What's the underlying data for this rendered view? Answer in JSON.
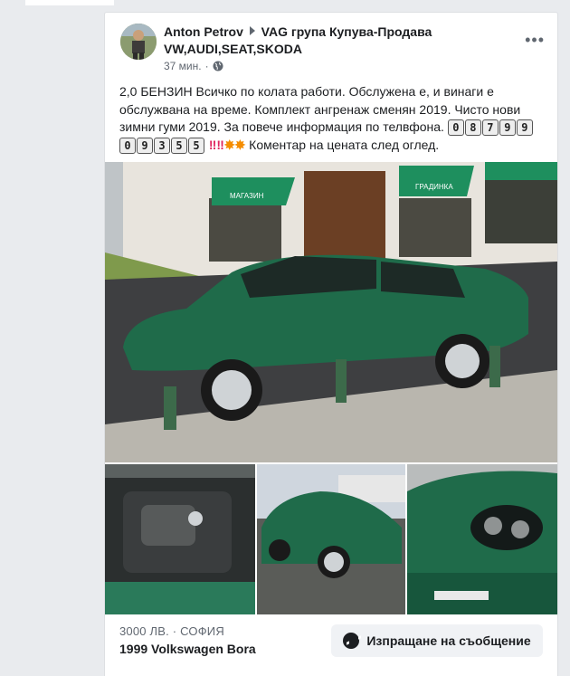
{
  "post": {
    "author": "Anton Petrov",
    "group": "VAG група Купува-Продава VW,AUDI,SEAT,SKODA",
    "time": "37 мин.",
    "privacy_icon": "globe-icon",
    "more_label": "•••",
    "text_part1": "2,0 БЕНЗИН  Всичко по колата работи. Обслужена е, и винаги е обслужвана на време. Комплект ангренаж сменян 2019. Чисто нови зимни гуми 2019. За повече информация по телвфона.",
    "phone_digits": [
      "0",
      "8",
      "7",
      "9",
      "9",
      "0",
      "9",
      "3",
      "5",
      "5"
    ],
    "text_part2": "Коментар на цената след оглед."
  },
  "listing": {
    "price": "3000 ЛВ.",
    "separator": "·",
    "location": "СОФИЯ",
    "title": "1999 Volkswagen Bora",
    "message_button": "Изпращане на съобщение"
  },
  "images": {
    "main_sign_left": "МАГАЗИН",
    "main_sign_right": "ГРАДИНКА"
  },
  "colors": {
    "car_green": "#1f6b4a",
    "awning_green": "#1e8f5e",
    "accent_blue": "#1877f2"
  }
}
